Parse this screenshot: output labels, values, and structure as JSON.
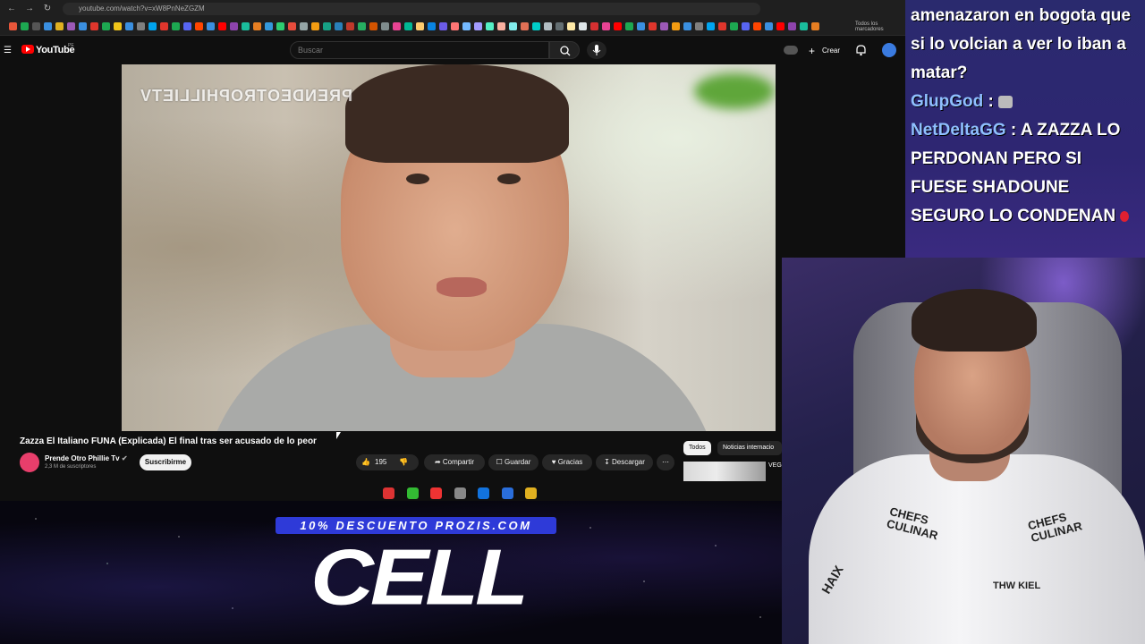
{
  "browser": {
    "url": "youtube.com/watch?v=xW8PnNeZGZM",
    "bookmarks_all_label": "Todos los marcadores",
    "bookmark_colors": [
      "#e8563a",
      "#1da851",
      "#555",
      "#3a8fe0",
      "#e0b020",
      "#9b59b6",
      "#3a8fe0",
      "#e0362c",
      "#1da851",
      "#f0c419",
      "#3a8fe0",
      "#7f7f7f",
      "#00a4ef",
      "#e0362c",
      "#1da851",
      "#5865f2",
      "#ff4500",
      "#3a8fe0",
      "#ff0000",
      "#8e44ad",
      "#1abc9c",
      "#e67e22",
      "#3498db",
      "#2ecc71",
      "#e74c3c",
      "#95a5a6",
      "#f39c12",
      "#16a085",
      "#2980b9",
      "#c0392b",
      "#27ae60",
      "#d35400",
      "#7f8c8d",
      "#e84393",
      "#00b894",
      "#fdcb6e",
      "#0984e3",
      "#6c5ce7",
      "#ff7675",
      "#74b9ff",
      "#a29bfe",
      "#55efc4",
      "#fab1a0",
      "#81ecec",
      "#e17055",
      "#00cec9",
      "#b2bec3",
      "#636e72",
      "#ffeaa7",
      "#dfe6e9",
      "#d63031",
      "#e84393",
      "#ff0000",
      "#1da851",
      "#3a8fe0",
      "#e0362c",
      "#9b59b6",
      "#f39c12",
      "#3a8fe0",
      "#7f7f7f",
      "#00a4ef",
      "#e0362c",
      "#1da851",
      "#5865f2",
      "#ff4500",
      "#3a8fe0",
      "#ff0000",
      "#8e44ad",
      "#1abc9c",
      "#e67e22",
      "#3498db"
    ]
  },
  "youtube": {
    "logo_text": "YouTube",
    "logo_region": "PE",
    "search_placeholder": "Buscar",
    "create_label": "Crear",
    "video_watermark": "PRENDEOTROPHILLIETV",
    "video_title": "Zazza El Italiano FUNA (Explicada) El final tras ser acusado de lo peor",
    "channel_name": "Prende Otro Phillie Tv",
    "channel_subs": "2,3 M de suscriptores",
    "subscribe_label": "Suscribirme",
    "likes": "195",
    "share_label": "Compartir",
    "save_label": "Guardar",
    "thanks_label": "Gracias",
    "download_label": "Descargar",
    "chips": [
      "Todos",
      "Noticias internacio"
    ],
    "related_title": "VEG COU"
  },
  "dock": {
    "icon_colors": [
      "#d33",
      "#3b3",
      "#e33",
      "#888",
      "#1273de",
      "#2a6edb",
      "#e0b020"
    ]
  },
  "overlay": {
    "promo_banner": "10% DESCUENTO PROZIS.COM",
    "promo_big": "CELL"
  },
  "chat": {
    "messages": [
      {
        "user": "",
        "text": "amenazaron en bogota que si lo volcian a ver lo iban a matar?"
      },
      {
        "user": "GlupGod",
        "text": ""
      },
      {
        "user": "NetDeltaGG",
        "text": "A ZAZZA LO PERDONAN PERO SI FUESE SHADOUNE SEGURO LO CONDENAN"
      }
    ]
  },
  "webcam": {
    "jersey_text_left": "CHEFS CULINAR",
    "jersey_text_right": "CHEFS CULINAR",
    "jersey_badge": "THW KIEL",
    "jersey_sleeve": "HAIX"
  }
}
